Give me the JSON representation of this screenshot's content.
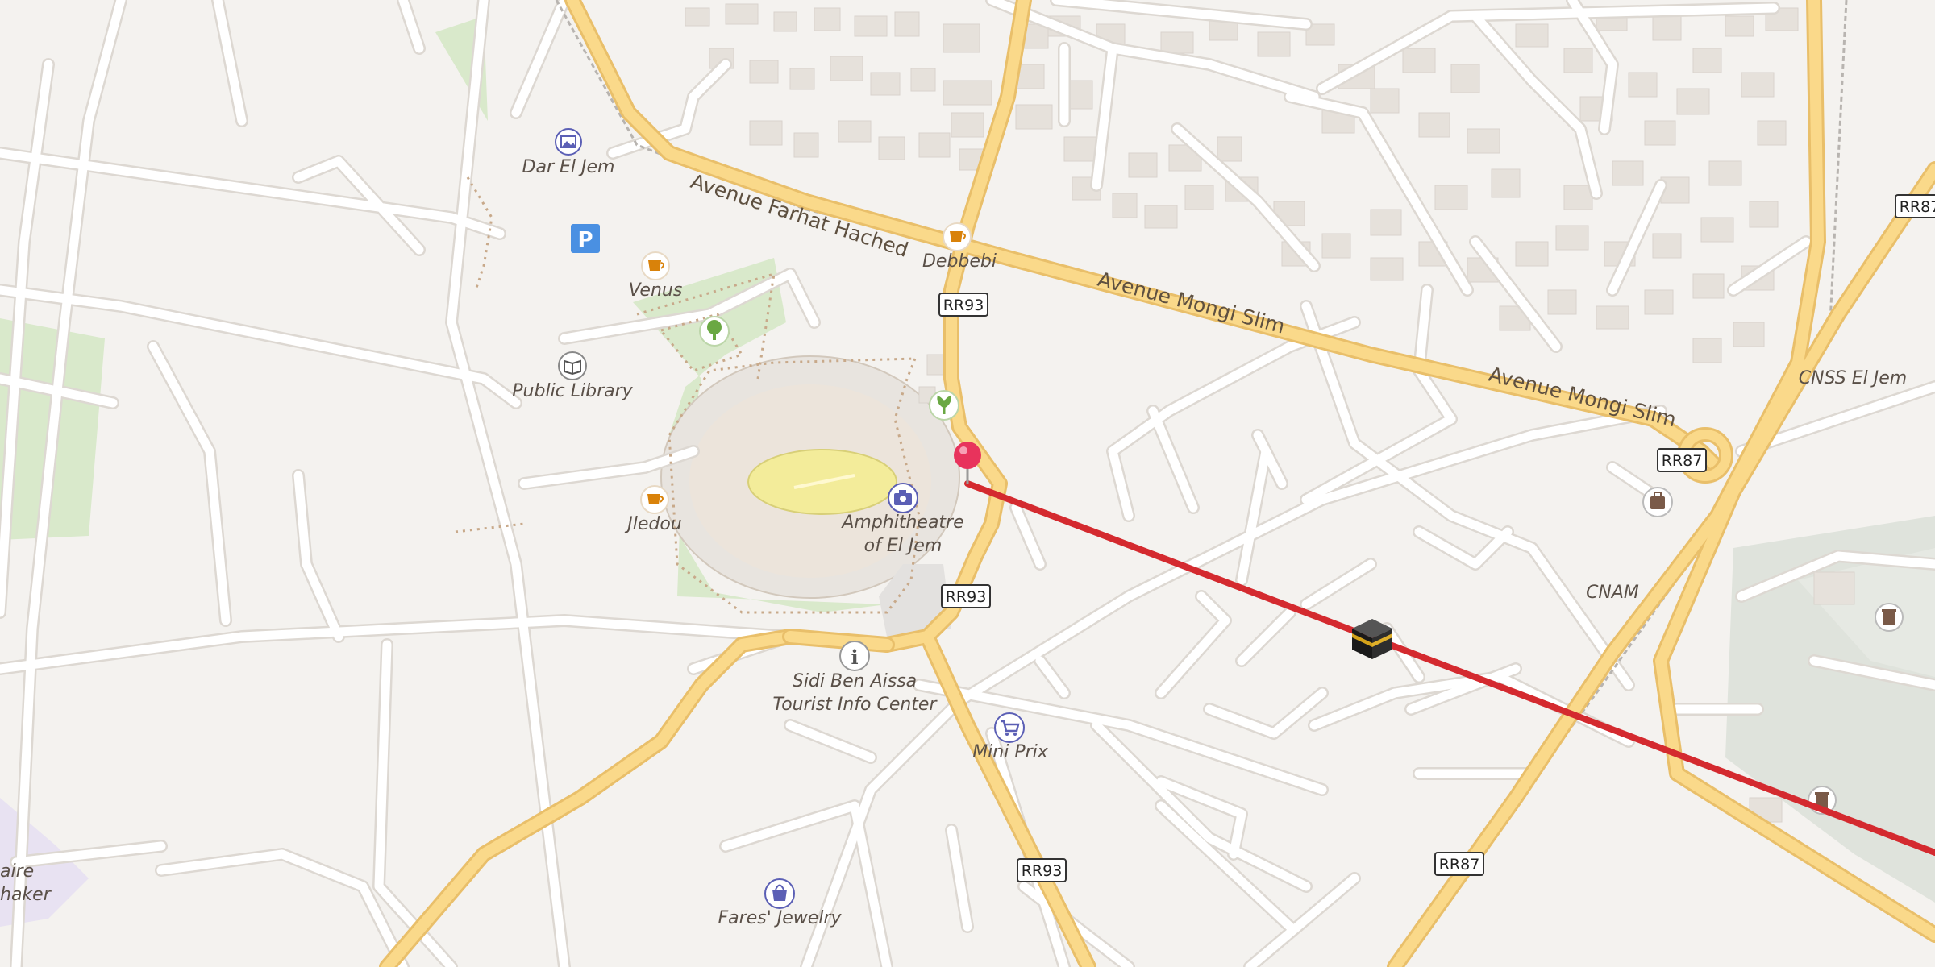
{
  "map": {
    "roads": {
      "farhat_hached": "Avenue Farhat Hached",
      "mongi_slim_1": "Avenue Mongi Slim",
      "mongi_slim_2": "Avenue Mongi Slim"
    },
    "shields": {
      "rr93_a": "RR93",
      "rr93_b": "RR93",
      "rr93_c": "RR93",
      "rr87_a": "RR87",
      "rr87_b": "RR87",
      "rr87_c": "RR87"
    },
    "places": {
      "dar_el_jem": "Dar El Jem",
      "venus": "Venus",
      "debbebi": "Debbebi",
      "public_library": "Public Library",
      "jledou": "Jledou",
      "amphitheatre_1": "Amphitheatre",
      "amphitheatre_2": "of El Jem",
      "tourist_1": "Sidi Ben Aissa",
      "tourist_2": "Tourist Info Center",
      "mini_prix": "Mini Prix",
      "fares_jewelry": "Fares' Jewelry",
      "cnss": "CNSS El Jem",
      "cnam": "CNAM",
      "cut_1": "aire",
      "cut_2": "haker"
    },
    "parking_label": "P",
    "colors": {
      "background": "#f4f2ef",
      "road_major": "#fad98a",
      "road_major_casing": "#e9bf6a",
      "road_minor": "#ffffff",
      "road_casing": "#ddd8d2",
      "building": "#e7e3de",
      "park": "#d6e8c9",
      "direction_line": "#d42a2f",
      "pin": "#e8335c",
      "poi_food": "#d9820a",
      "poi_culture": "#5b5fb5"
    },
    "icons": {
      "pin": "location-pin-icon",
      "kaaba": "kaaba-icon",
      "parking": "parking-icon"
    }
  }
}
